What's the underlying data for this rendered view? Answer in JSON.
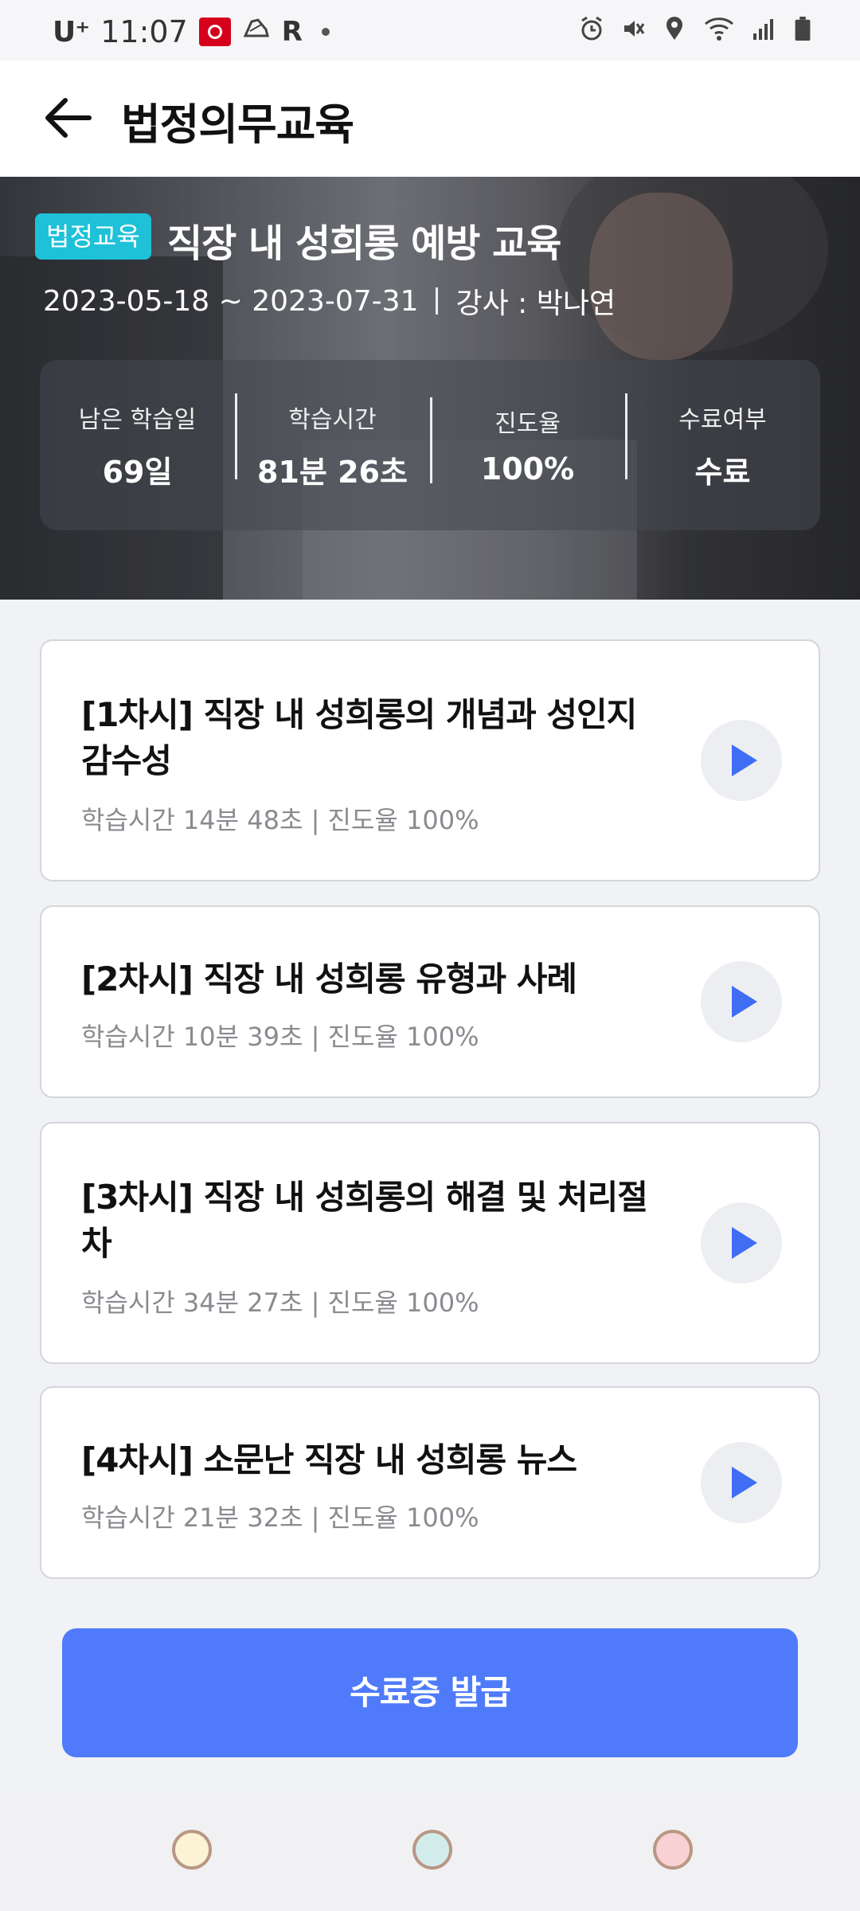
{
  "status_bar": {
    "carrier": "U⁺",
    "time": "11:07",
    "extra_letter": "R"
  },
  "header": {
    "title": "법정의무교육"
  },
  "course": {
    "badge": "법정교육",
    "title": "직장 내 성희롱 예방 교육",
    "period": "2023-05-18 ~ 2023-07-31",
    "instructor": "강사 : 박나연",
    "stats": [
      {
        "label": "남은 학습일",
        "value": "69일"
      },
      {
        "label": "학습시간",
        "value": "81분 26초"
      },
      {
        "label": "진도율",
        "value": "100%"
      },
      {
        "label": "수료여부",
        "value": "수료"
      }
    ]
  },
  "lessons": [
    {
      "title": "[1차시] 직장 내 성희롱의 개념과 성인지 감수성",
      "meta": "학습시간 14분 48초 | 진도율 100%"
    },
    {
      "title": "[2차시] 직장 내 성희롱 유형과 사례",
      "meta": "학습시간 10분 39초 | 진도율 100%"
    },
    {
      "title": "[3차시] 직장 내 성희롱의 해결 및 처리절차",
      "meta": "학습시간 34분 27초 | 진도율 100%"
    },
    {
      "title": "[4차시] 소문난 직장 내 성희롱 뉴스",
      "meta": "학습시간 21분 32초 | 진도율 100%"
    }
  ],
  "certificate_button": "수료증 발급",
  "nav_dots": [
    {
      "color": "#fbf3d3"
    },
    {
      "color": "#d2ecec"
    },
    {
      "color": "#f9d0d3"
    }
  ],
  "colors": {
    "accent": "#4f7bfa",
    "badge": "#1ec1d8",
    "play_icon": "#3f6ef5"
  }
}
